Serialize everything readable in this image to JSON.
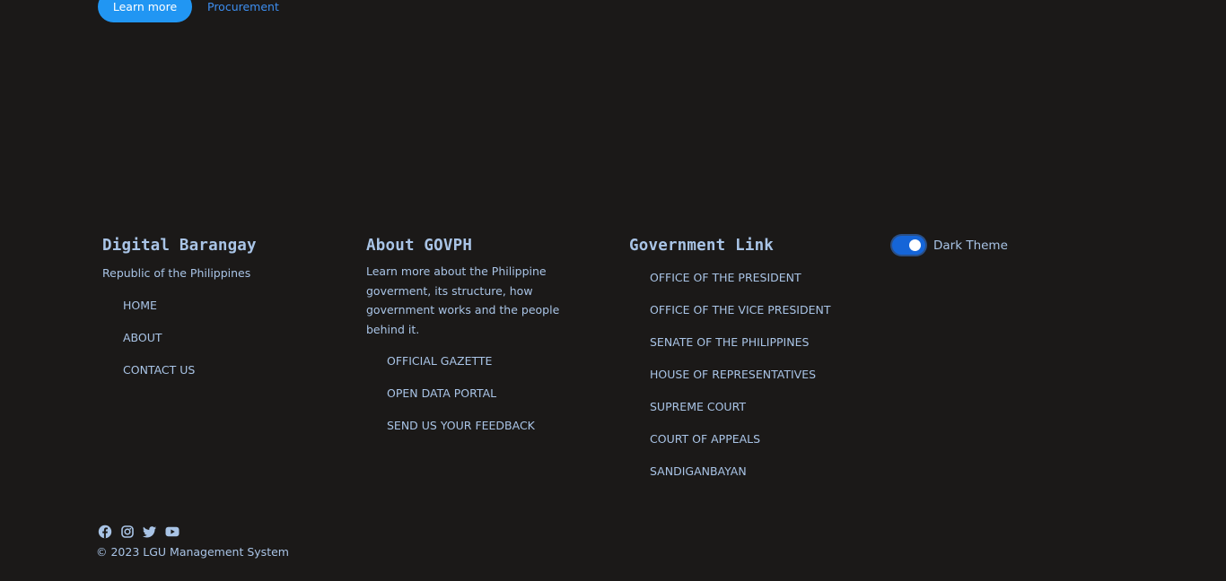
{
  "top": {
    "learn_more": "Learn more",
    "procurement": "Procurement"
  },
  "col1": {
    "title": "Digital Barangay",
    "subtitle": "Republic of the Philippines",
    "links": [
      "HOME",
      "ABOUT",
      "CONTACT US"
    ]
  },
  "col2": {
    "title": "About GOVPH",
    "description": "Learn more about the Philippine goverment, its structure, how government works and the people behind it.",
    "links": [
      "OFFICIAL GAZETTE",
      "OPEN DATA PORTAL",
      "SEND US YOUR FEEDBACK"
    ]
  },
  "col3": {
    "title": "Government Link",
    "links": [
      "OFFICE OF THE PRESIDENT",
      "OFFICE OF THE VICE PRESIDENT",
      "SENATE OF THE PHILIPPINES",
      "HOUSE OF REPRESENTATIVES",
      "SUPREME COURT",
      "COURT OF APPEALS",
      "SANDIGANBAYAN"
    ]
  },
  "theme_toggle": {
    "label": "Dark Theme",
    "on": true
  },
  "social": [
    "facebook-icon",
    "instagram-icon",
    "twitter-icon",
    "youtube-icon"
  ],
  "copyright": "© 2023 LGU Management System",
  "colors": {
    "background": "#1b1918",
    "text": "#a9c4e6",
    "accent": "#2196f3",
    "link": "#3d8ef0"
  }
}
